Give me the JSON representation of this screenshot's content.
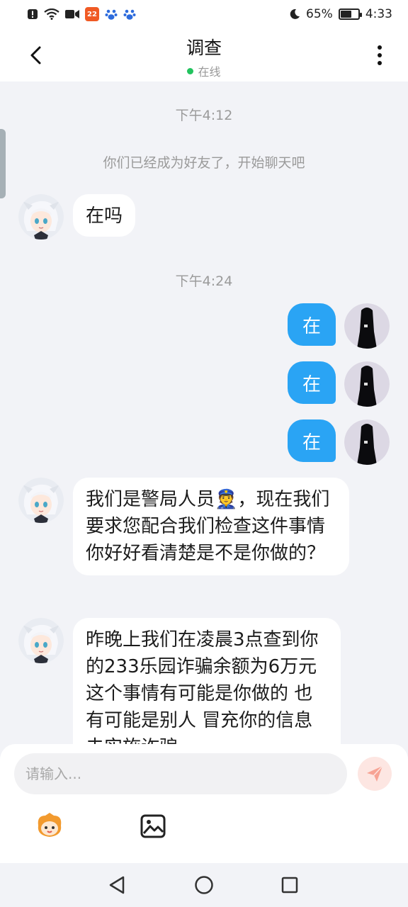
{
  "status_bar": {
    "battery": "65%",
    "time": "4:33",
    "battery_level": 0.65
  },
  "header": {
    "title": "调查",
    "status": "在线"
  },
  "messages": {
    "time1": "下午4:12",
    "system": "你们已经成为好友了，开始聊天吧",
    "in1": "在吗",
    "time2": "下午4:24",
    "out1": "在",
    "out2": "在",
    "out3": "在",
    "in2": "我们是警局人员👮，现在我们要求您配合我们检查这件事情 你好好看清楚是不是你做的？",
    "in3": "昨晚上我们在凌晨3点查到你的233乐园诈骗余额为6万元 这个事情有可能是你做的 也有可能是别人 冒充你的信息去实施诈骗"
  },
  "composer": {
    "placeholder": "请输入..."
  },
  "colors": {
    "accent": "#2aa4f4",
    "online": "#22c35e",
    "background": "#f2f3f7"
  },
  "icons": [
    "back-icon",
    "more-icon",
    "send-icon",
    "emoji-icon",
    "image-icon",
    "nav-back-icon",
    "nav-home-icon",
    "nav-recent-icon"
  ]
}
